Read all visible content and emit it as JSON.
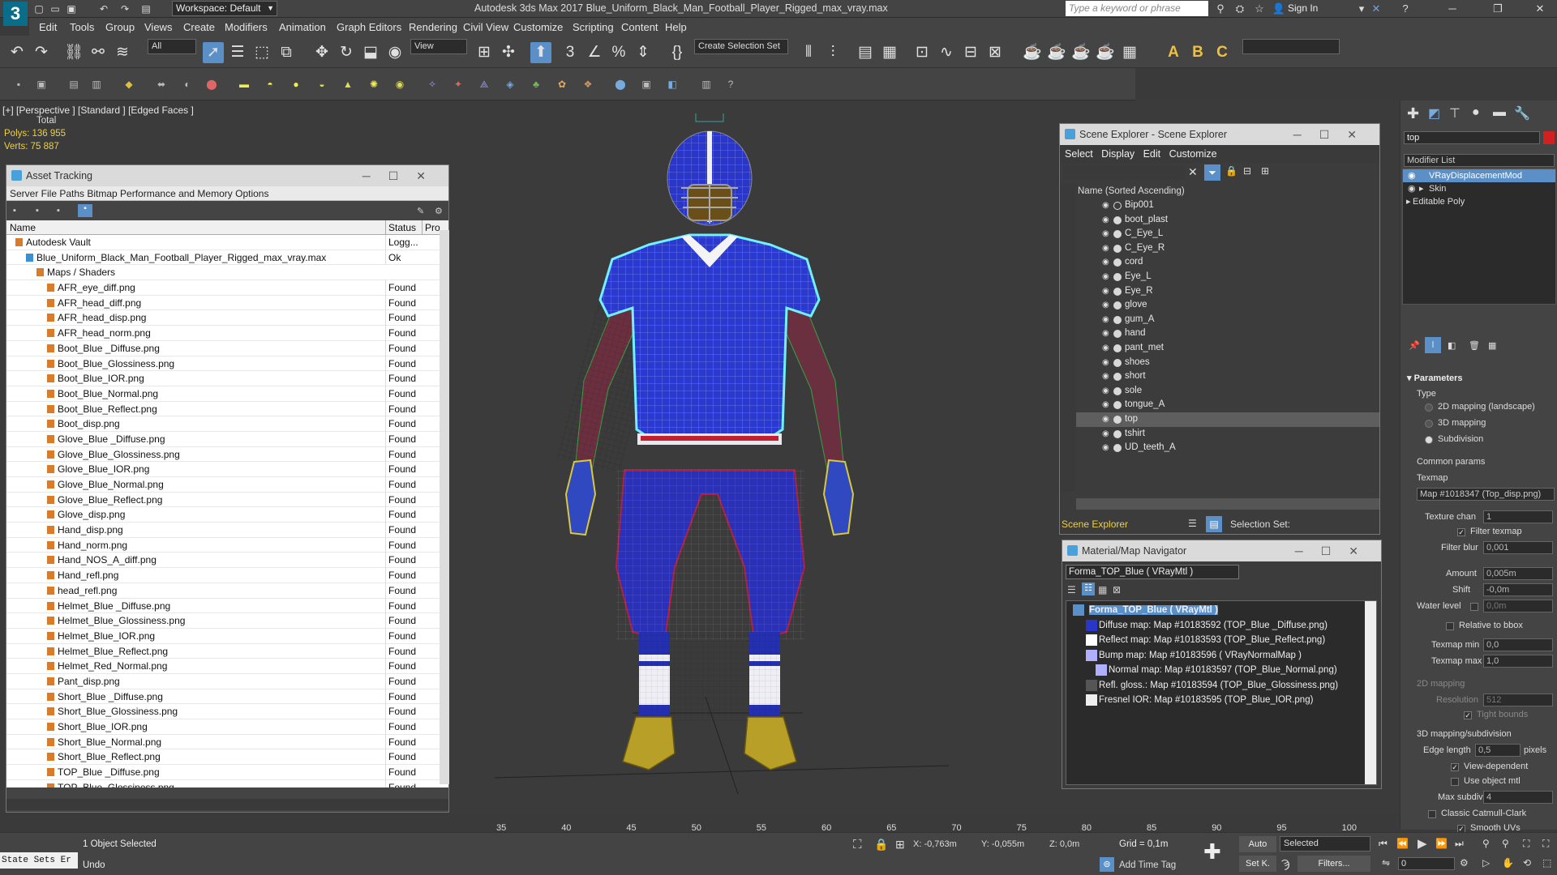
{
  "app": {
    "workspace": "Workspace: Default",
    "title": "Autodesk 3ds Max 2017      Blue_Uniform_Black_Man_Football_Player_Rigged_max_vray.max",
    "search_placeholder": "Type a keyword or phrase",
    "sign_in": "Sign In"
  },
  "menu": [
    "Edit",
    "Tools",
    "Group",
    "Views",
    "Create",
    "Modifiers",
    "Animation",
    "Graph Editors",
    "Rendering",
    "Civil View",
    "Customize",
    "Scripting",
    "Content",
    "Help"
  ],
  "toolbar": {
    "filter": "All",
    "view": "View",
    "selection_set": "Create Selection Set"
  },
  "viewport": {
    "label": "[+] [Perspective ]  [Standard ]  [Edged Faces ]",
    "stats_total": "Total",
    "polys": "Polys:    136 955",
    "verts": "Verts:    75 887"
  },
  "asset_tracking": {
    "title": "Asset Tracking",
    "menu": "Server  File  Paths  Bitmap Performance and Memory  Options",
    "col_name": "Name",
    "col_status": "Status",
    "col_pro": "Pro",
    "rows": [
      {
        "name": "Autodesk Vault",
        "status": "Logg...",
        "indent": 0
      },
      {
        "name": "Blue_Uniform_Black_Man_Football_Player_Rigged_max_vray.max",
        "status": "Ok",
        "indent": 1
      },
      {
        "name": "Maps / Shaders",
        "status": "",
        "indent": 2
      },
      {
        "name": "AFR_eye_diff.png",
        "status": "Found",
        "indent": 3
      },
      {
        "name": "AFR_head_diff.png",
        "status": "Found",
        "indent": 3
      },
      {
        "name": "AFR_head_disp.png",
        "status": "Found",
        "indent": 3
      },
      {
        "name": "AFR_head_norm.png",
        "status": "Found",
        "indent": 3
      },
      {
        "name": "Boot_Blue _Diffuse.png",
        "status": "Found",
        "indent": 3
      },
      {
        "name": "Boot_Blue_Glossiness.png",
        "status": "Found",
        "indent": 3
      },
      {
        "name": "Boot_Blue_IOR.png",
        "status": "Found",
        "indent": 3
      },
      {
        "name": "Boot_Blue_Normal.png",
        "status": "Found",
        "indent": 3
      },
      {
        "name": "Boot_Blue_Reflect.png",
        "status": "Found",
        "indent": 3
      },
      {
        "name": "Boot_disp.png",
        "status": "Found",
        "indent": 3
      },
      {
        "name": "Glove_Blue _Diffuse.png",
        "status": "Found",
        "indent": 3
      },
      {
        "name": "Glove_Blue_Glossiness.png",
        "status": "Found",
        "indent": 3
      },
      {
        "name": "Glove_Blue_IOR.png",
        "status": "Found",
        "indent": 3
      },
      {
        "name": "Glove_Blue_Normal.png",
        "status": "Found",
        "indent": 3
      },
      {
        "name": "Glove_Blue_Reflect.png",
        "status": "Found",
        "indent": 3
      },
      {
        "name": "Glove_disp.png",
        "status": "Found",
        "indent": 3
      },
      {
        "name": "Hand_disp.png",
        "status": "Found",
        "indent": 3
      },
      {
        "name": "Hand_norm.png",
        "status": "Found",
        "indent": 3
      },
      {
        "name": "Hand_NOS_A_diff.png",
        "status": "Found",
        "indent": 3
      },
      {
        "name": "Hand_refl.png",
        "status": "Found",
        "indent": 3
      },
      {
        "name": "head_refl.png",
        "status": "Found",
        "indent": 3
      },
      {
        "name": "Helmet_Blue _Diffuse.png",
        "status": "Found",
        "indent": 3
      },
      {
        "name": "Helmet_Blue_Glossiness.png",
        "status": "Found",
        "indent": 3
      },
      {
        "name": "Helmet_Blue_IOR.png",
        "status": "Found",
        "indent": 3
      },
      {
        "name": "Helmet_Blue_Reflect.png",
        "status": "Found",
        "indent": 3
      },
      {
        "name": "Helmet_Red_Normal.png",
        "status": "Found",
        "indent": 3
      },
      {
        "name": "Pant_disp.png",
        "status": "Found",
        "indent": 3
      },
      {
        "name": "Short_Blue _Diffuse.png",
        "status": "Found",
        "indent": 3
      },
      {
        "name": "Short_Blue_Glossiness.png",
        "status": "Found",
        "indent": 3
      },
      {
        "name": "Short_Blue_IOR.png",
        "status": "Found",
        "indent": 3
      },
      {
        "name": "Short_Blue_Normal.png",
        "status": "Found",
        "indent": 3
      },
      {
        "name": "Short_Blue_Reflect.png",
        "status": "Found",
        "indent": 3
      },
      {
        "name": "TOP_Blue _Diffuse.png",
        "status": "Found",
        "indent": 3
      },
      {
        "name": "TOP_Blue_Glossiness.png",
        "status": "Found",
        "indent": 3
      }
    ]
  },
  "scene_explorer": {
    "title": "Scene Explorer - Scene Explorer",
    "menu": [
      "Select",
      "Display",
      "Edit",
      "Customize"
    ],
    "column": "Name (Sorted Ascending)",
    "items": [
      "Bip001",
      "boot_plast",
      "C_Eye_L",
      "C_Eye_R",
      "cord",
      "Eye_L",
      "Eye_R",
      "glove",
      "gum_A",
      "hand",
      "pant_met",
      "shoes",
      "short",
      "sole",
      "tongue_A",
      "top",
      "tshirt",
      "UD_teeth_A"
    ],
    "selected": "top",
    "footer": "Scene Explorer",
    "selection_set": "Selection Set:"
  },
  "material_nav": {
    "title": "Material/Map Navigator",
    "material": "Forma_TOP_Blue  ( VRayMtl )",
    "rows": [
      "Forma_TOP_Blue  ( VRayMtl )",
      "Diffuse map: Map #10183592 (TOP_Blue _Diffuse.png)",
      "Reflect map: Map #10183593 (TOP_Blue_Reflect.png)",
      "Bump map: Map #10183596  ( VRayNormalMap )",
      "Normal map: Map #10183597 (TOP_Blue_Normal.png)",
      "Refl. gloss.: Map #10183594 (TOP_Blue_Glossiness.png)",
      "Fresnel IOR: Map #10183595 (TOP_Blue_IOR.png)"
    ]
  },
  "command_panel": {
    "object_name": "top",
    "modifier_list": "Modifier List",
    "stack": [
      "VRayDisplacementMod",
      "Skin",
      "Editable Poly"
    ],
    "parameters": "Parameters",
    "type": "Type",
    "opt_2d": "2D mapping (landscape)",
    "opt_3d": "3D mapping",
    "opt_sub": "Subdivision",
    "common": "Common params",
    "texmap": "Texmap",
    "texmap_val": "Map #1018347 (Top_disp.png)",
    "texture_chan": "Texture chan",
    "texture_chan_val": "1",
    "filter_texmap": "Filter texmap",
    "filter_blur": "Filter blur",
    "filter_blur_val": "0,001",
    "amount": "Amount",
    "amount_val": "0,005m",
    "shift": "Shift",
    "shift_val": "-0,0m",
    "water": "Water level",
    "water_val": "0,0m",
    "relative": "Relative to bbox",
    "texmap_min": "Texmap min",
    "texmap_min_val": "0,0",
    "texmap_max": "Texmap max",
    "texmap_max_val": "1,0",
    "mapping2d": "2D mapping",
    "resolution": "Resolution",
    "resolution_val": "512",
    "tight": "Tight bounds",
    "mapping3d": "3D mapping/subdivision",
    "edge": "Edge length",
    "edge_val": "0,5",
    "pixels": "pixels",
    "viewdep": "View-dependent",
    "useobj": "Use object mtl",
    "maxsub": "Max subdivs",
    "maxsub_val": "4",
    "catmull": "Classic Catmull-Clark",
    "smooth": "Smooth UVs"
  },
  "timeline": {
    "ticks": [
      "35",
      "40",
      "45",
      "50",
      "55",
      "60",
      "65",
      "70",
      "75",
      "80",
      "85",
      "90",
      "95",
      "100"
    ]
  },
  "status": {
    "state_sets": "State Sets Er",
    "selected": "1 Object Selected",
    "undo": "Undo",
    "x": "X: -0,763m",
    "y": "Y: -0,055m",
    "z": "Z: 0,0m",
    "grid": "Grid = 0,1m",
    "add_time_tag": "Add Time Tag",
    "auto": "Auto",
    "set_k": "Set K.",
    "selected_dd": "Selected",
    "filters": "Filters...",
    "frame": "0"
  },
  "colors": {
    "accent": "#5a8fc8",
    "jersey": "#2838c8",
    "select_cyan": "#70f0ff"
  }
}
